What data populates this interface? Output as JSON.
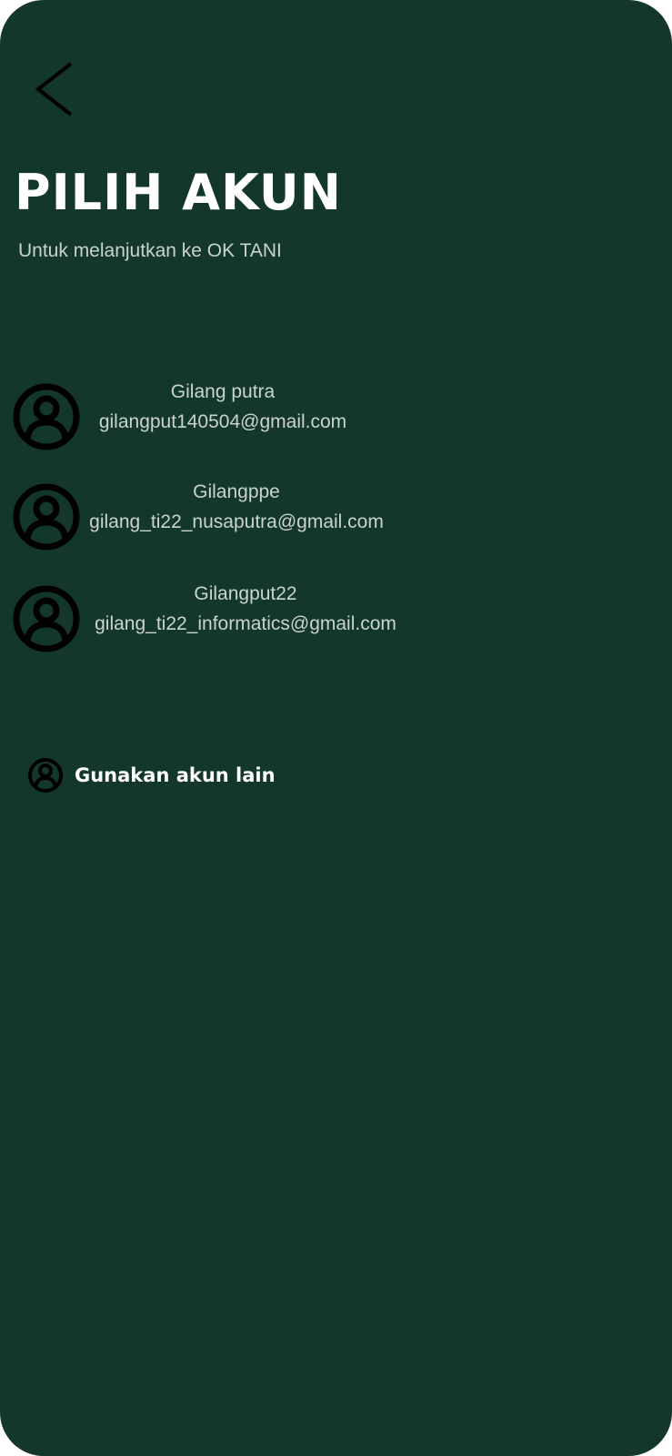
{
  "header": {
    "back_icon": "chevron-left-icon",
    "title": "PILIH AKUN",
    "subtitle": "Untuk melanjutkan ke OK TANI"
  },
  "accounts": [
    {
      "name": "Gilang putra",
      "email": "gilangput140504@gmail.com",
      "icon": "user-circle-icon"
    },
    {
      "name": "Gilangppe",
      "email": "gilang_ti22_nusaputra@gmail.com",
      "icon": "user-circle-icon"
    },
    {
      "name": "Gilangput22",
      "email": "gilang_ti22_informatics@gmail.com",
      "icon": "user-circle-icon"
    }
  ],
  "other_account": {
    "label": "Gunakan akun lain",
    "icon": "user-circle-icon"
  },
  "colors": {
    "background": "#13372b",
    "title": "#ffffff",
    "secondary_text": "#c9d3cf",
    "icon": "#000000"
  }
}
